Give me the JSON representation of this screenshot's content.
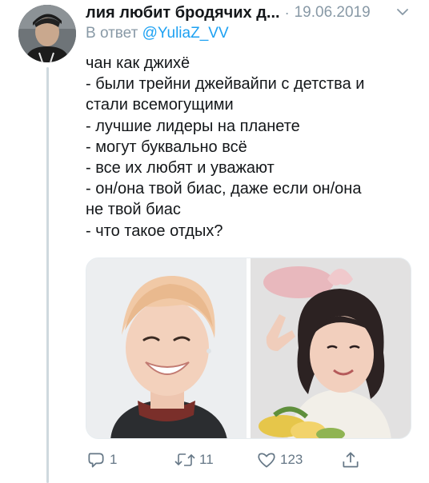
{
  "tweet": {
    "author_name": "лия любит бродячих д...",
    "date_separator": "·",
    "date": "19.06.2019",
    "reply_prefix": "В ответ",
    "reply_handle": "@YuliaZ_VV",
    "text_lines": [
      "чан как джихё",
      "- были трейни джейвайпи с детства и",
      "стали всемогущими",
      "- лучшие лидеры на планете",
      "- могут буквально всё",
      "- все их любят и уважают",
      "- он/она твой биас, даже если он/она",
      "не твой биас",
      "- что такое отдых?"
    ]
  },
  "media": {
    "count": 2,
    "photo_left": "portrait-smiling-man-blond-hair",
    "photo_right": "portrait-woman-peace-sign-bunny-ears"
  },
  "actions": {
    "reply": {
      "icon": "reply-icon",
      "count": "1"
    },
    "retweet": {
      "icon": "retweet-icon",
      "count": "11"
    },
    "like": {
      "icon": "heart-icon",
      "count": "123"
    },
    "share": {
      "icon": "share-icon",
      "count": ""
    }
  },
  "colors": {
    "text": "#14171a",
    "secondary": "#8899a6",
    "link": "#1da1f2",
    "icon": "#657786",
    "thread_line": "#cfd9de"
  }
}
